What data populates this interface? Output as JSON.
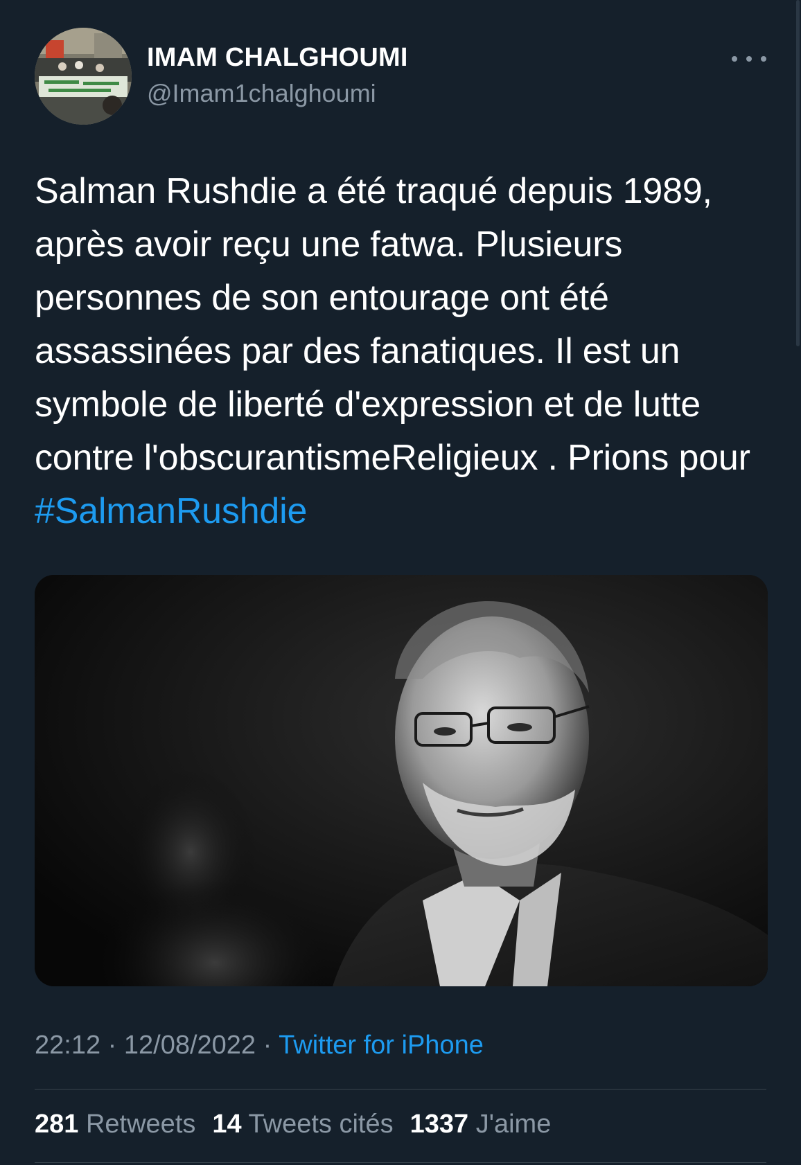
{
  "tweet": {
    "author": {
      "display_name": "IMAM CHALGHOUMI",
      "handle": "@Imam1chalghoumi"
    },
    "text_main": "Salman Rushdie a été traqué depuis 1989, après avoir reçu une fatwa. Plusieurs personnes de son entourage ont été assassinées par des fanatiques. Il est un symbole de liberté d'expression et de lutte contre l'obscurantismeReligieux . Prions pour ",
    "hashtag": "#SalmanRushdie",
    "time": "22:12",
    "separator": " · ",
    "date": "12/08/2022",
    "source": "Twitter for iPhone",
    "stats": {
      "retweets_count": "281",
      "retweets_label": "Retweets",
      "quotes_count": "14",
      "quotes_label": "Tweets cités",
      "likes_count": "1337",
      "likes_label": "J'aime"
    }
  },
  "colors": {
    "background": "#15202b",
    "accent": "#1d9bf0",
    "secondary_text": "#8b98a5",
    "divider": "#38444d"
  },
  "icons": {
    "more": "more-horizontal-icon"
  }
}
